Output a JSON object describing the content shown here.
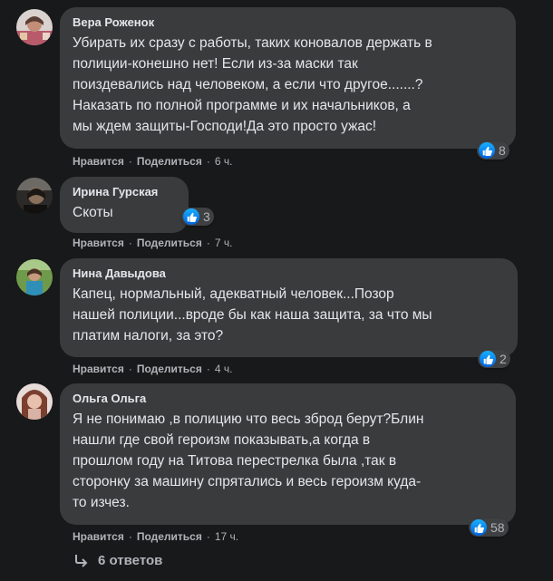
{
  "comments": [
    {
      "author": "Вера Роженок",
      "lines": [
        "Убирать их сразу с работы, таких коновалов держать в",
        "полиции-конешно нет! Если из-за маски так",
        "поиздевались над человеком, а если что другое.......?",
        "Наказать по полной программе и их начальников, а",
        "мы ждем защиты-Господи!Да это просто ужас!"
      ],
      "reactions": "8",
      "like": "Нравится",
      "share": "Поделиться",
      "time": "6 ч."
    },
    {
      "author": "Ирина Гурская",
      "lines": [
        "Скоты"
      ],
      "reactions": "3",
      "like": "Нравится",
      "share": "Поделиться",
      "time": "7 ч."
    },
    {
      "author": "Нина Давыдова",
      "lines": [
        "Капец, нормальный, адекватный человек...Позор",
        "нашей полиции...вроде бы как наша защита, за что мы",
        "платим налоги, за это?"
      ],
      "reactions": "2",
      "like": "Нравится",
      "share": "Поделиться",
      "time": "4 ч."
    },
    {
      "author": "Ольга Ольга",
      "lines": [
        "Я не понимаю ,в полицию что весь зброд берут?Блин",
        "нашли где свой героизм показывать,а когда в",
        "прошлом году на Титова перестрелка была ,так в",
        "сторонку за машину спрятались и весь героизм куда-",
        "то изчез."
      ],
      "reactions": "58",
      "like": "Нравится",
      "share": "Поделиться",
      "time": "17 ч."
    }
  ],
  "replies_label": "6 ответов",
  "icons": {
    "reaction": "like-icon",
    "replies": "reply-arrow-icon"
  },
  "colors": {
    "background": "#18191a",
    "bubble": "#3a3b3c",
    "like": "#1877f2",
    "secondary_text": "#b0b3b8"
  }
}
